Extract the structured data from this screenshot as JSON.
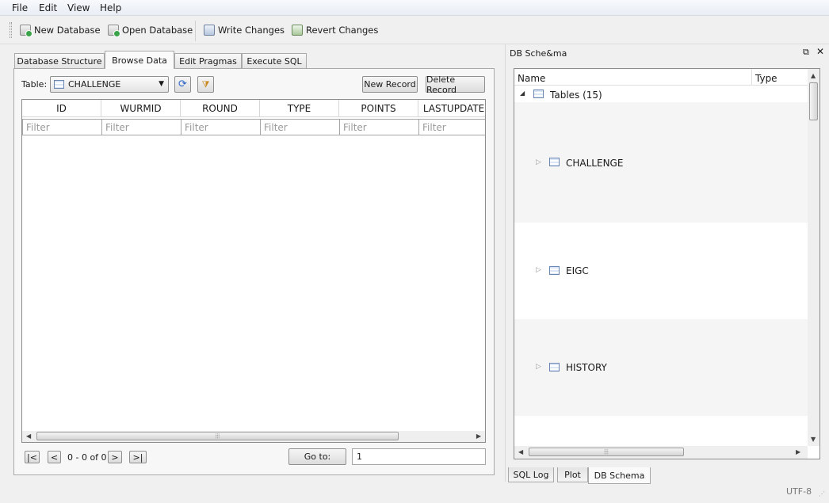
{
  "menu": [
    "File",
    "Edit",
    "View",
    "Help"
  ],
  "toolbar": {
    "new_database": "New Database",
    "open_database": "Open Database",
    "write_changes": "Write Changes",
    "revert_changes": "Revert Changes"
  },
  "tabs": [
    "Database Structure",
    "Browse Data",
    "Edit Pragmas",
    "Execute SQL"
  ],
  "active_tab": "Browse Data",
  "browse": {
    "table_label": "Table:",
    "table_selected": "CHALLENGE",
    "new_record": "New Record",
    "delete_record": "Delete Record",
    "columns": [
      "ID",
      "WURMID",
      "ROUND",
      "TYPE",
      "POINTS",
      "LASTUPDATE"
    ],
    "filter_placeholder": "Filter",
    "nav": {
      "first": "|<",
      "prev": "<",
      "range": "0 - 0 of 0",
      "next": ">",
      "last": ">|",
      "goto_label": "Go to:",
      "goto_value": "1"
    }
  },
  "dock": {
    "title": "DB Sche&ma",
    "columns": [
      "Name",
      "Type"
    ],
    "root": "Tables (15)",
    "tables": [
      "CHALLENGE",
      "EIGC",
      "HISTORY"
    ],
    "bottom_tabs": [
      "SQL Log",
      "Plot",
      "DB Schema"
    ],
    "active_bottom_tab": "DB Schema"
  },
  "status": {
    "encoding": "UTF-8"
  }
}
